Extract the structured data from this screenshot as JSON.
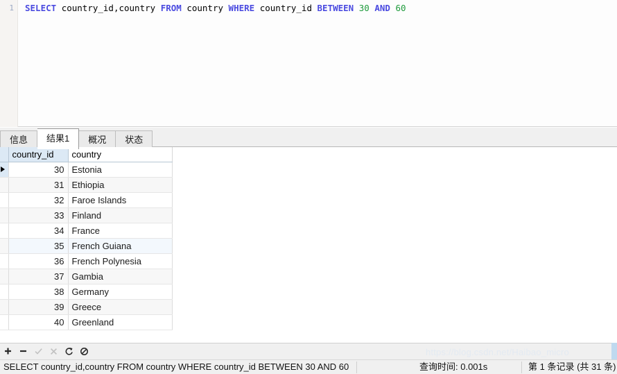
{
  "editor": {
    "line_number": "1",
    "tokens": [
      {
        "t": "SELECT",
        "k": "kw"
      },
      {
        "t": " ",
        "k": "idn"
      },
      {
        "t": "country_id,country",
        "k": "idn"
      },
      {
        "t": " ",
        "k": "idn"
      },
      {
        "t": "FROM",
        "k": "kw"
      },
      {
        "t": " ",
        "k": "idn"
      },
      {
        "t": "country",
        "k": "idn"
      },
      {
        "t": " ",
        "k": "idn"
      },
      {
        "t": "WHERE",
        "k": "kw"
      },
      {
        "t": " ",
        "k": "idn"
      },
      {
        "t": "country_id",
        "k": "idn"
      },
      {
        "t": " ",
        "k": "idn"
      },
      {
        "t": "BETWEEN",
        "k": "kw"
      },
      {
        "t": " ",
        "k": "idn"
      },
      {
        "t": "30",
        "k": "num"
      },
      {
        "t": " ",
        "k": "idn"
      },
      {
        "t": "AND",
        "k": "kw"
      },
      {
        "t": " ",
        "k": "idn"
      },
      {
        "t": "60",
        "k": "num"
      }
    ],
    "full_text": "SELECT country_id,country FROM country WHERE country_id BETWEEN 30 AND 60"
  },
  "tabs": [
    {
      "label": "信息",
      "active": false
    },
    {
      "label": "结果1",
      "active": true
    },
    {
      "label": "概况",
      "active": false
    },
    {
      "label": "状态",
      "active": false
    }
  ],
  "grid": {
    "columns": [
      "country_id",
      "country"
    ],
    "rows": [
      {
        "country_id": "30",
        "country": "Estonia"
      },
      {
        "country_id": "31",
        "country": "Ethiopia"
      },
      {
        "country_id": "32",
        "country": "Faroe Islands"
      },
      {
        "country_id": "33",
        "country": "Finland"
      },
      {
        "country_id": "34",
        "country": "France"
      },
      {
        "country_id": "35",
        "country": "French Guiana"
      },
      {
        "country_id": "36",
        "country": "French Polynesia"
      },
      {
        "country_id": "37",
        "country": "Gambia"
      },
      {
        "country_id": "38",
        "country": "Germany"
      },
      {
        "country_id": "39",
        "country": "Greece"
      },
      {
        "country_id": "40",
        "country": "Greenland"
      }
    ],
    "selected_row_index": 0
  },
  "toolbar": {
    "buttons": [
      {
        "name": "add-record-button",
        "glyph": "+",
        "disabled": false
      },
      {
        "name": "delete-record-button",
        "glyph": "−",
        "disabled": false
      },
      {
        "name": "apply-change-button",
        "glyph": "✓",
        "disabled": true
      },
      {
        "name": "cancel-change-button",
        "glyph": "✕",
        "disabled": true
      },
      {
        "name": "refresh-button",
        "glyph": "⟳",
        "disabled": false
      },
      {
        "name": "stop-button",
        "glyph": "⃠",
        "disabled": false
      }
    ]
  },
  "statusbar": {
    "sql": "SELECT country_id,country FROM country WHERE country_id BETWEEN 30 AND 60",
    "query_time": "查询时间: 0.001s",
    "records": "第 1 条记录 (共 31 条)"
  },
  "watermark": "https://blog.csdn.net/Haibao_micro",
  "colors": {
    "keyword": "#4a4ae0",
    "number": "#1f9b3c",
    "identifier": "#000000",
    "header_bg": "#dce9f5",
    "stripe_bg": "#f7f7f7"
  }
}
